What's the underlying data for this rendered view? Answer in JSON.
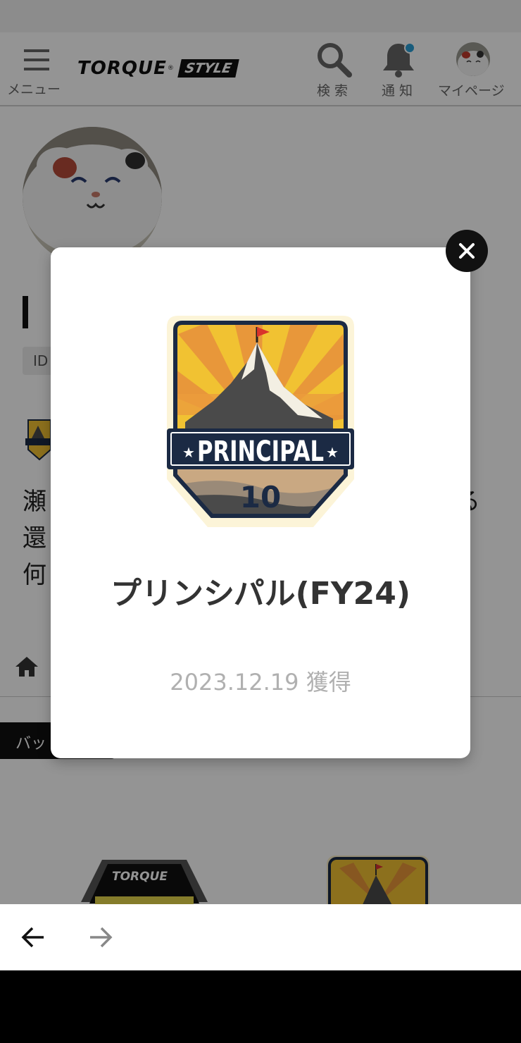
{
  "header": {
    "menu_label": "メニュー",
    "logo_main": "TORQUE",
    "logo_sub": "STYLE",
    "search_label": "検 索",
    "notifications_label": "通 知",
    "mypage_label": "マイページ"
  },
  "profile": {
    "id_prefix": "ID",
    "text_line_1_start": "瀬",
    "text_line_1_end": "る",
    "text_line_2_start": "還",
    "text_line_3_start": "何"
  },
  "tabs": {
    "badge_tab_label": "バッ"
  },
  "badge_modal": {
    "badge_banner_text": "PRINCIPAL",
    "badge_number": "10",
    "title": "プリンシパル(FY24)",
    "acquired_date": "2023.12.19 獲得"
  },
  "grid": {
    "first_badge_text": "TORQUE"
  },
  "colors": {
    "overlay": "rgba(0,0,0,0.42)",
    "notification_dot": "#2a9fd6",
    "badge_navy": "#1b2a44",
    "badge_yellow": "#f1c232",
    "badge_orange": "#e8973a"
  },
  "icons": [
    "hamburger-icon",
    "search-icon",
    "bell-icon",
    "close-icon",
    "home-icon",
    "arrow-left-icon",
    "arrow-right-icon"
  ]
}
